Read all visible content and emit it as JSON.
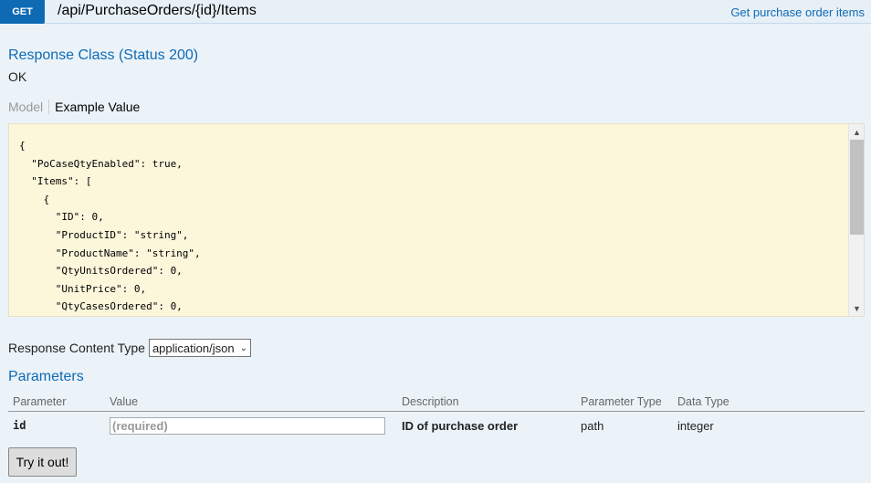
{
  "endpoint": {
    "method": "GET",
    "path": "/api/PurchaseOrders/{id}/Items",
    "summary": "Get purchase order items"
  },
  "response_class": {
    "title": "Response Class (Status 200)",
    "status_text": "OK",
    "tabs": {
      "model": "Model",
      "example": "Example Value"
    },
    "example_json": "{\n  \"PoCaseQtyEnabled\": true,\n  \"Items\": [\n    {\n      \"ID\": 0,\n      \"ProductID\": \"string\",\n      \"ProductName\": \"string\",\n      \"QtyUnitsOrdered\": 0,\n      \"UnitPrice\": 0,\n      \"QtyCasesOrdered\": 0,"
  },
  "content_type": {
    "label": "Response Content Type",
    "selected": "application/json"
  },
  "parameters": {
    "title": "Parameters",
    "headers": {
      "parameter": "Parameter",
      "value": "Value",
      "description": "Description",
      "param_type": "Parameter Type",
      "data_type": "Data Type"
    },
    "rows": [
      {
        "name": "id",
        "placeholder": "(required)",
        "description": "ID of purchase order",
        "param_type": "path",
        "data_type": "integer"
      }
    ]
  },
  "actions": {
    "try_label": "Try it out!"
  },
  "icons": {
    "scroll_up": "chevron-up-icon",
    "scroll_down": "chevron-down-icon",
    "select_arrow": "chevron-down-icon"
  },
  "colors": {
    "accent": "#0f6ab4",
    "json_background": "#fcf6db",
    "page_background": "#ebf3f9"
  }
}
